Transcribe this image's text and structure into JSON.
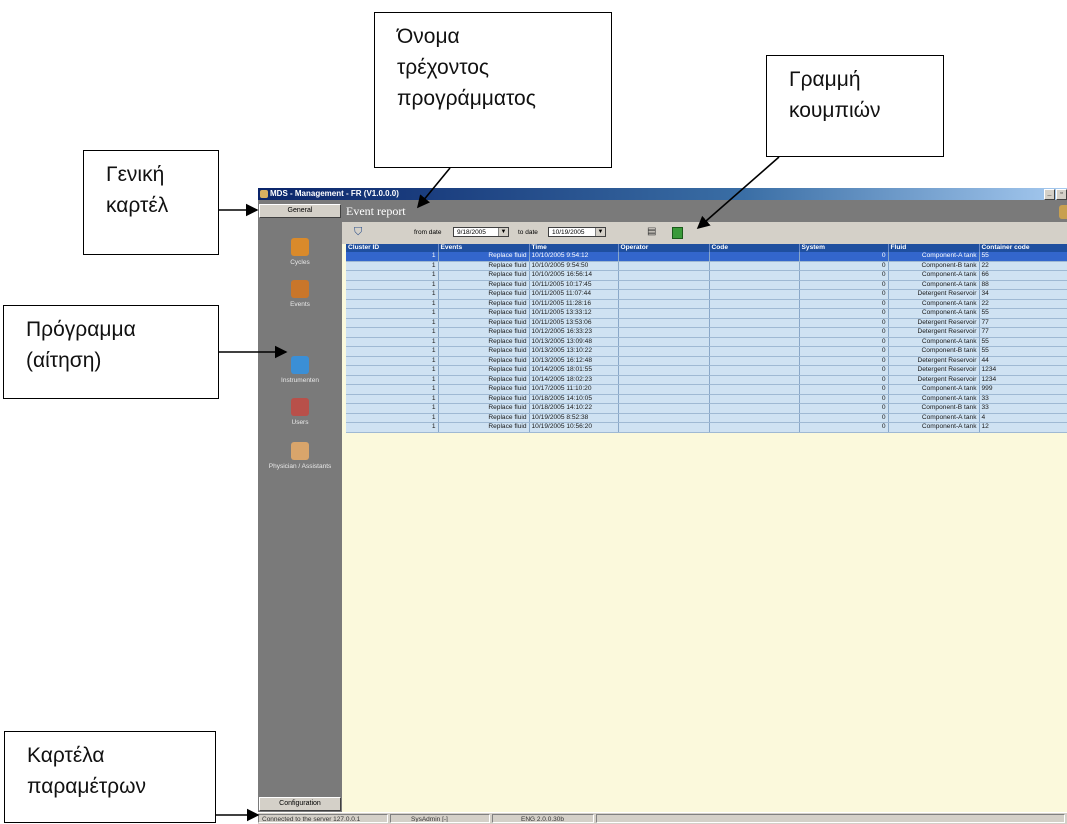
{
  "app": {
    "title": "MDS - Management - FR  (V1.0.0.0)",
    "window_buttons": [
      "_",
      "▫"
    ]
  },
  "sidebar": {
    "general_tab": "General",
    "items": [
      {
        "label": "Cycles",
        "icon": "cycles-icon",
        "color": "#d98a2b"
      },
      {
        "label": "Events",
        "icon": "events-icon",
        "color": "#c9762a"
      },
      {
        "label": "Instrumenten",
        "icon": "instruments-icon",
        "color": "#3b8fd6"
      },
      {
        "label": "Users",
        "icon": "users-icon",
        "color": "#b8504a"
      },
      {
        "label": "Physician / Assistants",
        "icon": "physician-icon",
        "color": "#d9a56b"
      }
    ],
    "config_tab": "Configuration"
  },
  "report": {
    "title": "Event report",
    "toolbar": {
      "from_label": "from date",
      "from_value": "9/18/2005",
      "to_label": "to date",
      "to_value": "10/19/2005"
    },
    "columns": [
      "Cluster ID",
      "Events",
      "Time",
      "Operator",
      "Code",
      "System",
      "Fluid",
      "Container code"
    ],
    "rows": [
      [
        "1",
        "Replace fluid",
        "10/10/2005 9:54:12",
        "",
        "",
        "0",
        "Component-A tank",
        "55"
      ],
      [
        "1",
        "Replace fluid",
        "10/10/2005 9:54:50",
        "",
        "",
        "0",
        "Component-B tank",
        "22"
      ],
      [
        "1",
        "Replace fluid",
        "10/10/2005 16:56:14",
        "",
        "",
        "0",
        "Component-A tank",
        "66"
      ],
      [
        "1",
        "Replace fluid",
        "10/11/2005 10:17:45",
        "",
        "",
        "0",
        "Component-A tank",
        "88"
      ],
      [
        "1",
        "Replace fluid",
        "10/11/2005 11:07:44",
        "",
        "",
        "0",
        "Detergent Reservoir",
        "34"
      ],
      [
        "1",
        "Replace fluid",
        "10/11/2005 11:28:16",
        "",
        "",
        "0",
        "Component-A tank",
        "22"
      ],
      [
        "1",
        "Replace fluid",
        "10/11/2005 13:33:12",
        "",
        "",
        "0",
        "Component-A tank",
        "55"
      ],
      [
        "1",
        "Replace fluid",
        "10/11/2005 13:53:06",
        "",
        "",
        "0",
        "Detergent Reservoir",
        "77"
      ],
      [
        "1",
        "Replace fluid",
        "10/12/2005 16:33:23",
        "",
        "",
        "0",
        "Detergent Reservoir",
        "77"
      ],
      [
        "1",
        "Replace fluid",
        "10/13/2005 13:09:48",
        "",
        "",
        "0",
        "Component-A tank",
        "55"
      ],
      [
        "1",
        "Replace fluid",
        "10/13/2005 13:10:22",
        "",
        "",
        "0",
        "Component-B tank",
        "55"
      ],
      [
        "1",
        "Replace fluid",
        "10/13/2005 16:12:48",
        "",
        "",
        "0",
        "Detergent Reservoir",
        "44"
      ],
      [
        "1",
        "Replace fluid",
        "10/14/2005 18:01:55",
        "",
        "",
        "0",
        "Detergent Reservoir",
        "1234"
      ],
      [
        "1",
        "Replace fluid",
        "10/14/2005 18:02:23",
        "",
        "",
        "0",
        "Detergent Reservoir",
        "1234"
      ],
      [
        "1",
        "Replace fluid",
        "10/17/2005 11:10:20",
        "",
        "",
        "0",
        "Component-A tank",
        "999"
      ],
      [
        "1",
        "Replace fluid",
        "10/18/2005 14:10:05",
        "",
        "",
        "0",
        "Component-A tank",
        "33"
      ],
      [
        "1",
        "Replace fluid",
        "10/18/2005 14:10:22",
        "",
        "",
        "0",
        "Component-B tank",
        "33"
      ],
      [
        "1",
        "Replace fluid",
        "10/19/2005 8:52:38",
        "",
        "",
        "0",
        "Component-A tank",
        "4"
      ],
      [
        "1",
        "Replace fluid",
        "10/19/2005 10:56:20",
        "",
        "",
        "0",
        "Component-A tank",
        "12"
      ]
    ]
  },
  "statusbar": {
    "server": "Connected to the server 127.0.0.1",
    "user": "SysAdmin [-]",
    "version": "ENG 2.0.0.30b"
  },
  "callouts": {
    "program_name": "Όνομα\nτρέχοντος\nπρογράμματος",
    "button_bar": "Γραμμή\nκουμπιών",
    "general_tab": "Γενική\nκαρτέλ",
    "program": "Πρόγραμμα\n(αίτηση)",
    "params_tab": "Καρτέλα\nπαραμέτρων"
  }
}
